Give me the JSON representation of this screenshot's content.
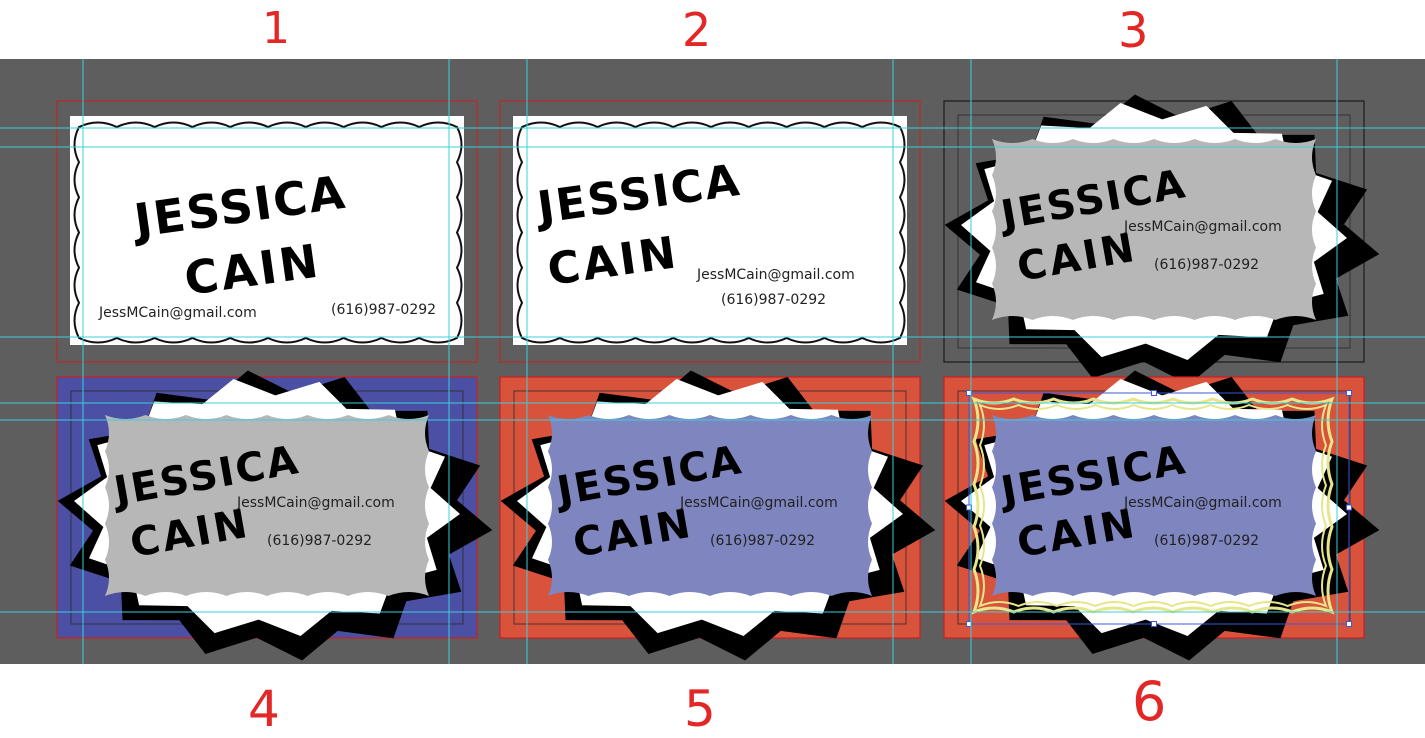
{
  "cards": [
    {
      "number": "1",
      "first_name": "JESSICA",
      "last_name": "CAIN",
      "email": "JessMCain@gmail.com",
      "phone": "(616)987-0292",
      "background_color": "#ffffff",
      "panel_color": "#ffffff",
      "style": "cloud"
    },
    {
      "number": "2",
      "first_name": "JESSICA",
      "last_name": "CAIN",
      "email": "JessMCain@gmail.com",
      "phone": "(616)987-0292",
      "background_color": "#ffffff",
      "panel_color": "#ffffff",
      "style": "cloud"
    },
    {
      "number": "3",
      "first_name": "JESSICA",
      "last_name": "CAIN",
      "email": "JessMCain@gmail.com",
      "phone": "(616)987-0292",
      "background_color": "#5e5e5e",
      "panel_color": "#b7b7b7",
      "style": "spiky"
    },
    {
      "number": "4",
      "first_name": "JESSICA",
      "last_name": "CAIN",
      "email": "JessMCain@gmail.com",
      "phone": "(616)987-0292",
      "background_color": "#4c50a4",
      "panel_color": "#b7b7b7",
      "style": "spiky"
    },
    {
      "number": "5",
      "first_name": "JESSICA",
      "last_name": "CAIN",
      "email": "JessMCain@gmail.com",
      "phone": "(616)987-0292",
      "background_color": "#d9523b",
      "panel_color": "#7e85bf",
      "style": "spiky"
    },
    {
      "number": "6",
      "first_name": "JESSICA",
      "last_name": "CAIN",
      "email": "JessMCain@gmail.com",
      "phone": "(616)987-0292",
      "background_color": "#d9523b",
      "panel_color": "#7e85bf",
      "style": "spiky-selected"
    }
  ],
  "colors": {
    "canvas": "#5e5e5e",
    "bleed_line": "#cc1f1f",
    "guide_line": "#39d0dc",
    "annotation": "#e32626",
    "selection_outline": "#e7e68a",
    "selection_handle": "#3a5ad8"
  }
}
